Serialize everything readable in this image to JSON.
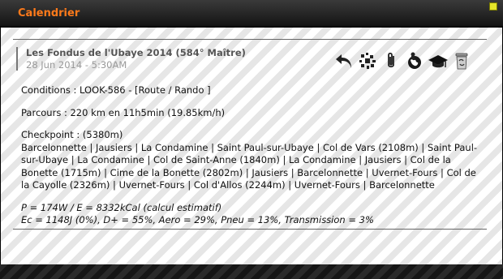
{
  "window": {
    "title": "Calendrier"
  },
  "event": {
    "title": "Les Fondus de l'Ubaye 2014 (584° Maître)",
    "date": "28 Jun 2014 - 5:30AM"
  },
  "toolbar": {
    "icons": [
      "back-arrow-icon",
      "sparkle-icon",
      "paperclip-icon",
      "globe-person-icon",
      "graduation-cap-icon",
      "trash-icon"
    ]
  },
  "details": {
    "conditions": "Conditions : LOOK-586 - [Route / Rando ]",
    "parcours": "Parcours : 220 km en 11h5min (19.85km/h)",
    "checkpoint_label": "Checkpoint : (5380m)",
    "checkpoint_list": "Barcelonnette | Jausiers | La Condamine | Saint Paul-sur-Ubaye | Col de Vars (2108m) | Saint Paul-sur-Ubaye | La Condamine | Col de Saint-Anne (1840m) | La Condamine | Jausiers | Col de la Bonette (1715m) | Cime de la Bonette (2802m) | Jausiers | Barcelonnette | Uvernet-Fours | Col de la Cayolle (2326m) | Uvernet-Fours | Col d'Allos (2244m) | Uvernet-Fours | Barcelonnette",
    "calc_line1": "P = 174W / E = 8332kCal (calcul estimatif)",
    "calc_line2": "Ec = 1148J (0%), D+ = 55%, Aero = 29%, Pneu = 13%, Transmission = 3%"
  }
}
